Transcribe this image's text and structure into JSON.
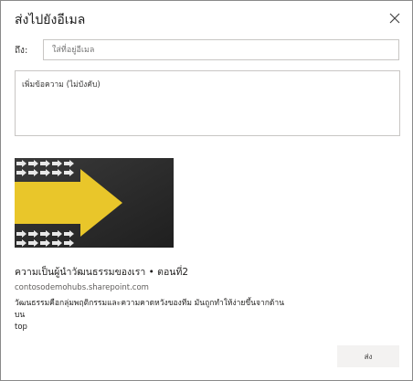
{
  "dialog": {
    "title": "ส่งไปยังอีเมล",
    "close_icon": "close-icon"
  },
  "to": {
    "label": "ถึง:",
    "placeholder": "ใส่ที่อยู่อีเมล"
  },
  "message": {
    "placeholder": "เพิ่มข้อความ (ไม่บังคับ)"
  },
  "link_preview": {
    "title": "ความเป็นผู้นำวัฒนธรรมของเรา • ตอนที่2",
    "domain": "contosodemohubs.sharepoint.com",
    "description_line1": "วัฒนธรรมคือกลุ่มพฤติกรรมและความคาดหวังของทีม มันถูกทำให้ง่ายขึ้นจากด้านบน",
    "description_line2": "top",
    "colors": {
      "thumbnail_background": "#2a2a2a",
      "arrow_yellow": "#e9c62a"
    }
  },
  "actions": {
    "send_label": "ส่ง"
  }
}
